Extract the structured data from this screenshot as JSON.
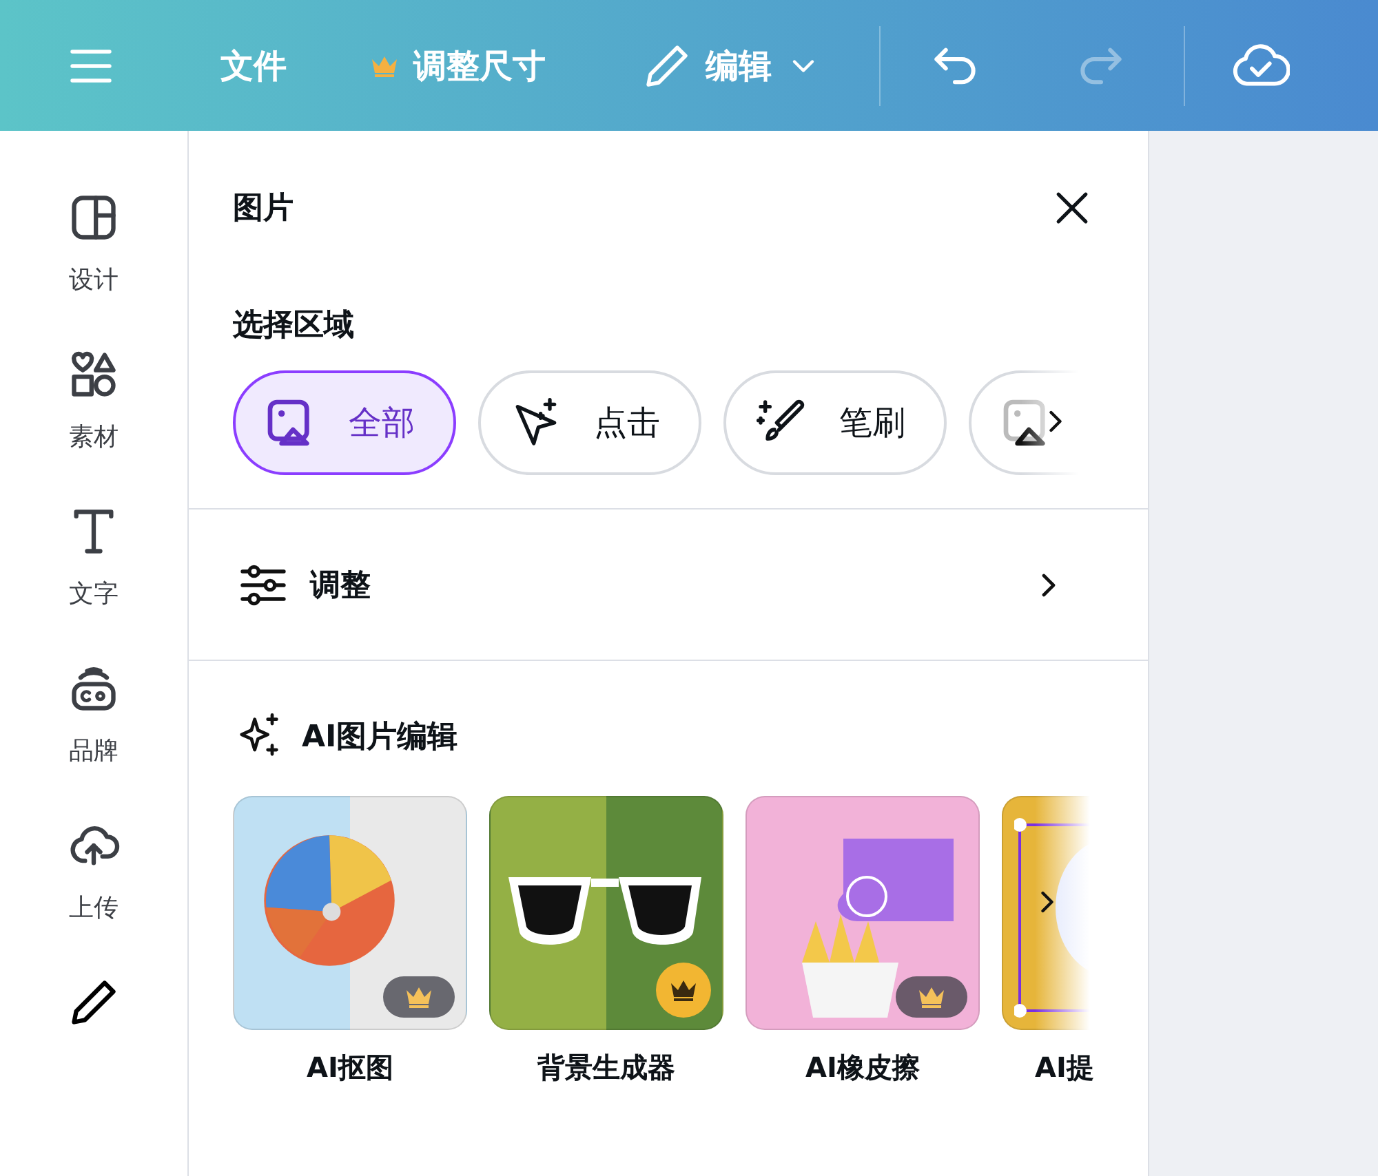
{
  "toolbar": {
    "file": "文件",
    "resize": {
      "label": "调整尺寸",
      "premium": true
    },
    "edit": "编辑",
    "undo": {
      "disabled": false
    },
    "redo": {
      "disabled": true
    }
  },
  "sidebar": {
    "items": [
      {
        "label": "设计",
        "kind": "layout"
      },
      {
        "label": "素材",
        "kind": "shapes"
      },
      {
        "label": "文字",
        "kind": "text"
      },
      {
        "label": "品牌",
        "kind": "brand"
      },
      {
        "label": "上传",
        "kind": "upload"
      }
    ]
  },
  "panel": {
    "title": "图片",
    "select_area": {
      "label": "选择区域",
      "chips": [
        {
          "label": "全部",
          "kind": "image",
          "selected": true
        },
        {
          "label": "点击",
          "kind": "click",
          "selected": false
        },
        {
          "label": "笔刷",
          "kind": "brush",
          "selected": false
        },
        {
          "kind": "image",
          "selected": false
        }
      ]
    },
    "adjust": "调整",
    "ai_edit": {
      "title": "AI图片编辑",
      "tools": [
        {
          "label": "AI抠图",
          "kind": "ball",
          "badge": {
            "kind": "dark"
          }
        },
        {
          "label": "背景生成器",
          "kind": "glasses",
          "badge": {
            "kind": "gold"
          }
        },
        {
          "label": "AI橡皮擦",
          "kind": "fries",
          "badge": {
            "kind": "dark"
          }
        },
        {
          "label": "AI提",
          "kind": "balloon"
        }
      ]
    }
  }
}
